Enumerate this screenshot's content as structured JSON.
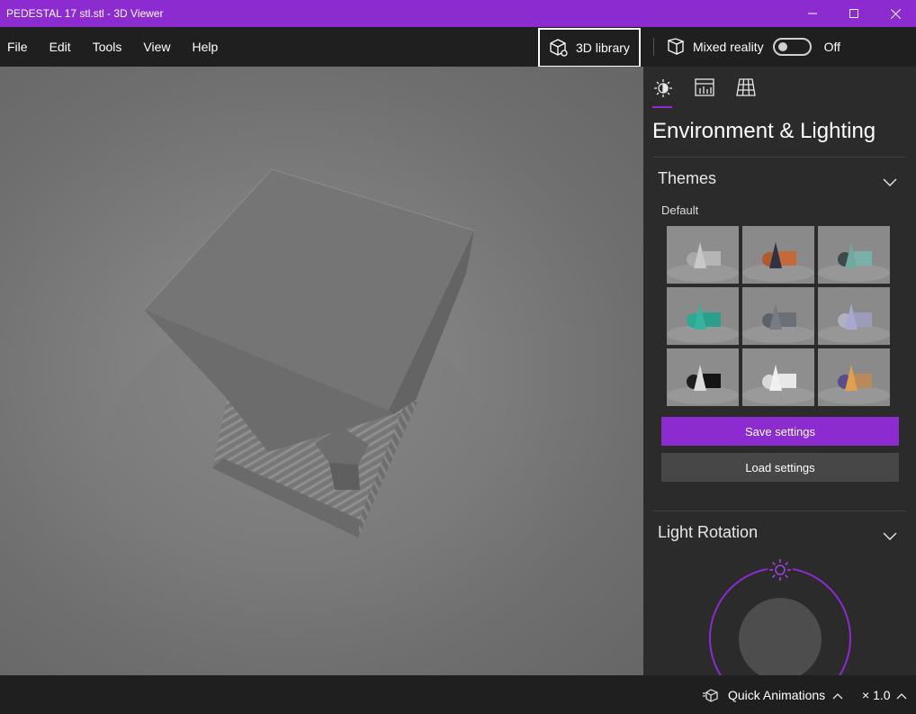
{
  "window": {
    "title": "PEDESTAL 17 stl.stl - 3D Viewer"
  },
  "menu": {
    "items": [
      "File",
      "Edit",
      "Tools",
      "View",
      "Help"
    ]
  },
  "toolbar": {
    "library_label": "3D library",
    "mixed_reality_label": "Mixed reality",
    "mixed_reality_state": "Off"
  },
  "panel": {
    "tabs": [
      "environment-lighting-tab",
      "stats-tab",
      "mesh-tab"
    ],
    "heading": "Environment & Lighting",
    "themes": {
      "title": "Themes",
      "selected_label": "Default",
      "items": [
        "default",
        "copper",
        "teal-dark",
        "teal",
        "slate",
        "lavender",
        "black",
        "white",
        "rainbow"
      ]
    },
    "save_label": "Save settings",
    "load_label": "Load settings",
    "light_rotation": {
      "title": "Light Rotation"
    }
  },
  "status": {
    "quick_animations_label": "Quick Animations",
    "speed_label": "× 1.0"
  },
  "colors": {
    "accent": "#8b2bd0",
    "panel_bg": "#2b2b2b",
    "chrome_bg": "#1f1f1f"
  }
}
